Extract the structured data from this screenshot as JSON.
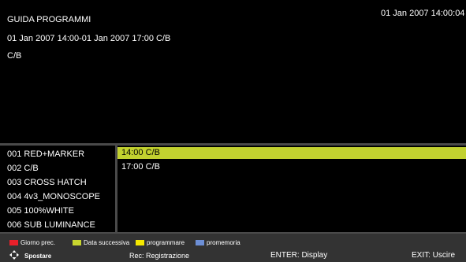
{
  "header": {
    "title": "GUIDA PROGRAMMI",
    "clock": "01 Jan 2007 14:00:04",
    "time_range": "01 Jan 2007 14:00-01 Jan 2007 17:00 C/B",
    "current_program": "C/B"
  },
  "channels": [
    {
      "label": "001 RED+MARKER"
    },
    {
      "label": "002 C/B"
    },
    {
      "label": "003 CROSS HATCH"
    },
    {
      "label": "004 4v3_MONOSCOPE"
    },
    {
      "label": "005 100%WHITE"
    },
    {
      "label": "006 SUB LUMINANCE"
    }
  ],
  "programs": [
    {
      "label": "14:00 C/B",
      "selected": true
    },
    {
      "label": "17:00 C/B",
      "selected": false
    }
  ],
  "legend": [
    {
      "label": "Giorno prec.",
      "color": "#e8202a"
    },
    {
      "label": "Data successiva",
      "color": "#c8d62f"
    },
    {
      "label": "programmare",
      "color": "#f5e800"
    },
    {
      "label": "promemoria",
      "color": "#6d8fd6"
    }
  ],
  "keys": {
    "move_label": "Spostare",
    "move_icon": "directional-pad-icon",
    "record": "Rec: Registrazione",
    "enter": "ENTER: Display",
    "exit": "EXIT: Uscire"
  }
}
